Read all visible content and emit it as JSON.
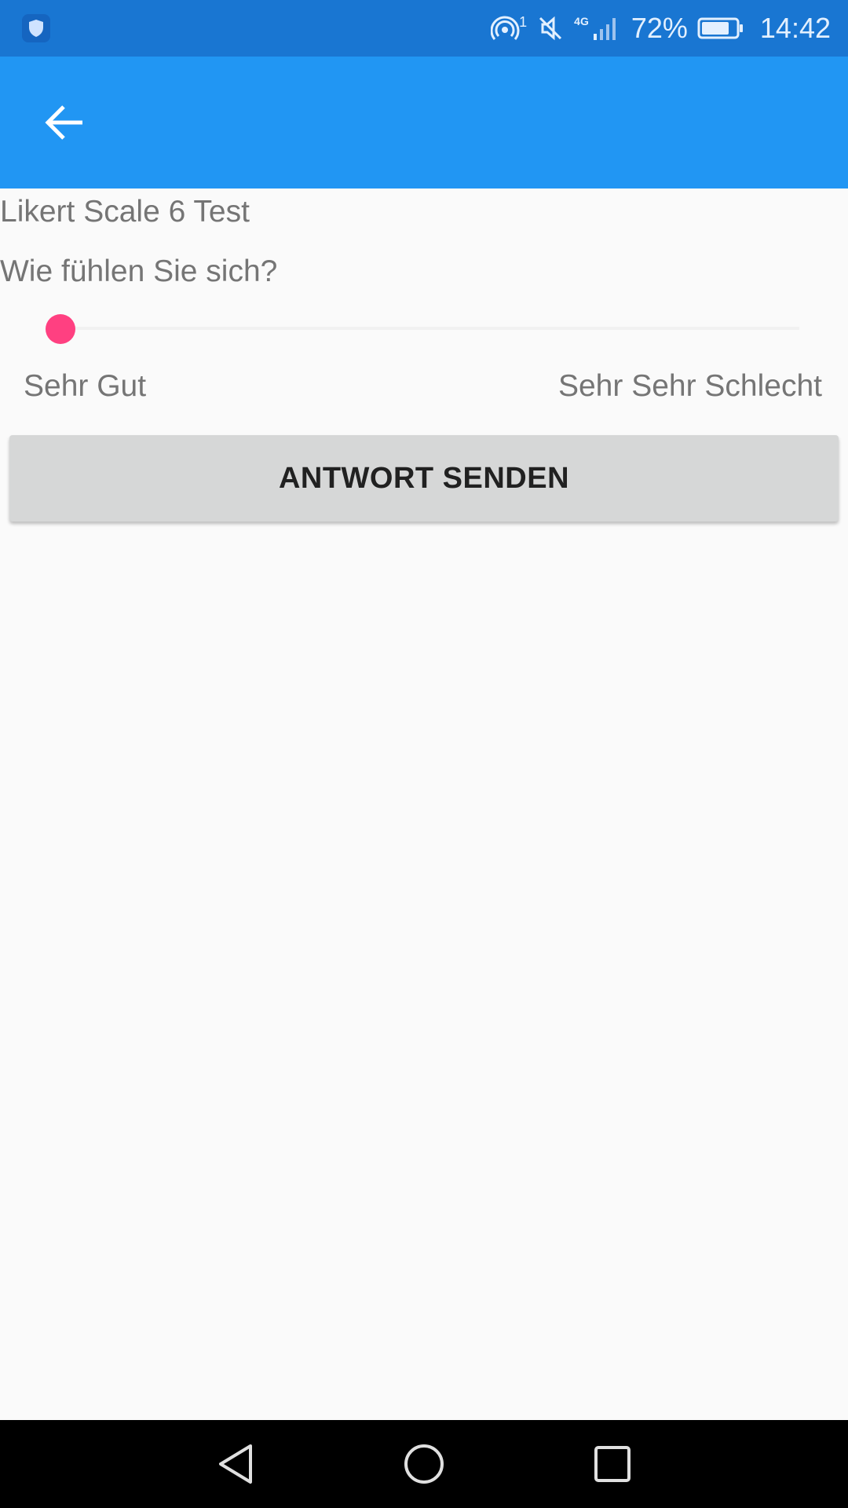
{
  "status_bar": {
    "battery_percent": "72%",
    "time": "14:42",
    "network_label": "4G",
    "hotspot_badge": "1",
    "icons": [
      "shield-icon",
      "hotspot-icon",
      "mute-icon",
      "signal-icon",
      "battery-icon"
    ]
  },
  "app_bar": {
    "back_icon": "arrow-left-icon",
    "color": "#2196f3"
  },
  "survey": {
    "title": "Likert Scale 6 Test",
    "question": "Wie fühlen Sie sich?",
    "scale_min_label": "Sehr Gut",
    "scale_max_label": "Sehr Sehr Schlecht",
    "slider_value_fraction": 0,
    "thumb_color": "#ff4081",
    "submit_label": "ANTWORT SENDEN"
  },
  "nav_bar": {
    "icons": [
      "back-triangle-icon",
      "home-circle-icon",
      "recents-square-icon"
    ]
  }
}
